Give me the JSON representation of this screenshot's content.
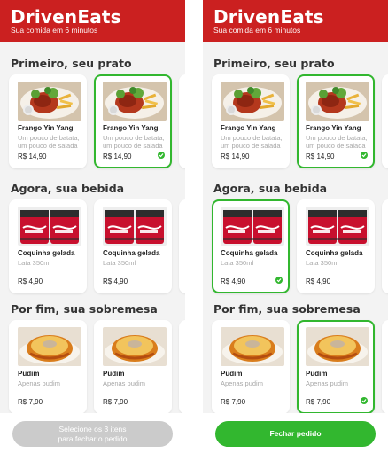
{
  "app": {
    "brand": "DrivenEats",
    "tagline": "Sua comida em 6 minutos"
  },
  "sections": {
    "dishes": "Primeiro, seu prato",
    "drinks": "Agora, sua bebida",
    "desserts": "Por fim, sua sobremesa"
  },
  "items": {
    "dish": {
      "name": "Frango Yin Yang",
      "description": "Um pouco de batata, um pouco de salada",
      "price": "R$ 14,90"
    },
    "drink": {
      "name": "Coquinha gelada",
      "description": "Lata 350ml",
      "price": "R$ 4,90"
    },
    "dessert": {
      "name": "Pudim",
      "description": "Apenas pudim",
      "price": "R$ 7,90"
    }
  },
  "screens": {
    "left": {
      "selected": {
        "dish": 2,
        "drink": 0,
        "dessert": 0
      },
      "cta_label": "Selecione os 3 itens\npara fechar o pedido",
      "cta_state": "disabled"
    },
    "right": {
      "selected": {
        "dish": 2,
        "drink": 1,
        "dessert": 2
      },
      "cta_label": "Fechar pedido",
      "cta_state": "enabled"
    }
  },
  "colors": {
    "brand_red": "#cb2020",
    "select_green": "#32b72f",
    "background": "#f3f3f3",
    "disabled_gray": "#cbcbcb"
  },
  "icons": {
    "selected": "checkmark-circle-icon"
  }
}
